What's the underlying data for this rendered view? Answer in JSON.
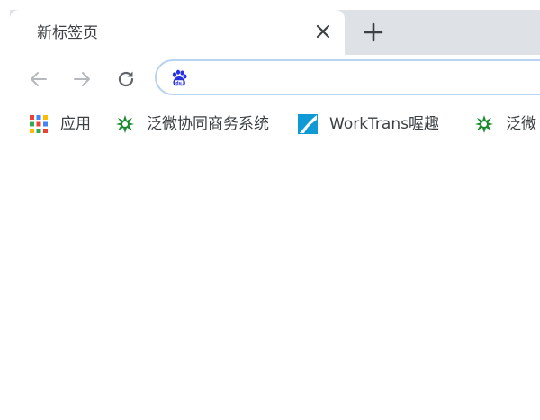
{
  "tab": {
    "title": "新标签页",
    "close_icon": "close-icon"
  },
  "new_tab_icon": "plus-icon",
  "toolbar": {
    "back_icon": "arrow-left-icon",
    "forward_icon": "arrow-right-icon",
    "reload_icon": "reload-icon",
    "omnibox": {
      "icon": "baidu-paw-icon",
      "value": ""
    }
  },
  "bookmarks": [
    {
      "label": "应用",
      "icon": "apps-grid-icon"
    },
    {
      "label": "泛微协同商务系统",
      "icon": "weaver-logo-icon"
    },
    {
      "label": "WorkTrans喔趣",
      "icon": "worktrans-logo-icon"
    },
    {
      "label": "泛微",
      "icon": "weaver-logo-icon"
    }
  ],
  "colors": {
    "tabstrip": "#dee1e6",
    "omnibox_border": "#b7d3ef",
    "baidu_blue": "#2932e1",
    "weaver_green": "#1a8a2e",
    "worktrans_blue": "#0f9ad6"
  }
}
